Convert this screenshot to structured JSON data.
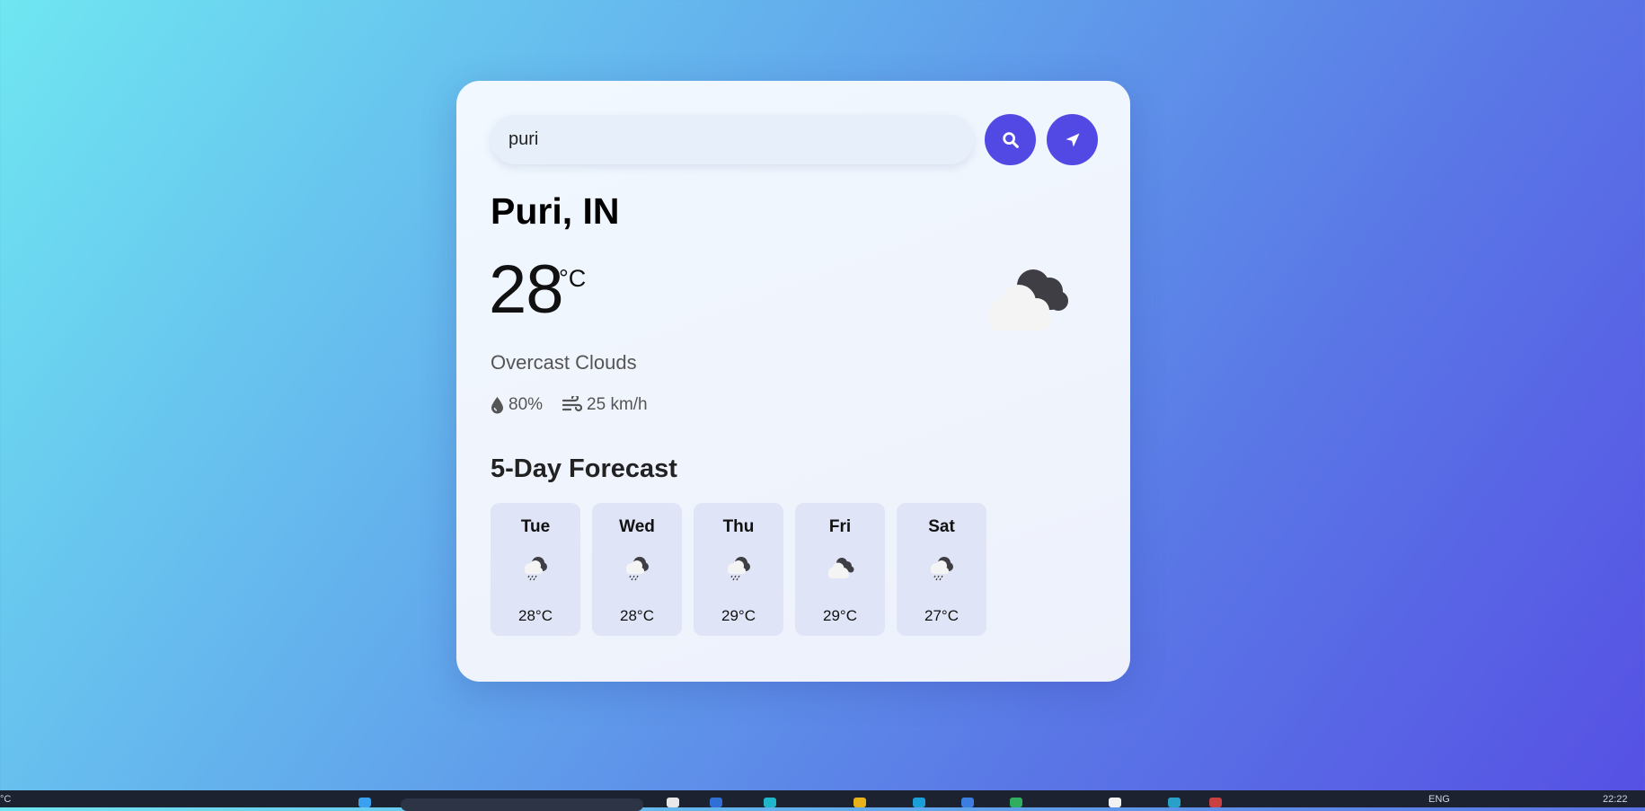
{
  "search": {
    "value": "puri"
  },
  "current": {
    "city": "Puri, IN",
    "temp": "28",
    "unit": "°C",
    "condition": "Overcast Clouds",
    "humidity": "80%",
    "wind": "25 km/h",
    "icon": "overcast-cloud-icon"
  },
  "forecast": {
    "title": "5-Day Forecast",
    "days": [
      {
        "day": "Tue",
        "temp": "28°C",
        "icon": "rain-cloud-icon"
      },
      {
        "day": "Wed",
        "temp": "28°C",
        "icon": "rain-cloud-icon"
      },
      {
        "day": "Thu",
        "temp": "29°C",
        "icon": "rain-cloud-icon"
      },
      {
        "day": "Fri",
        "temp": "29°C",
        "icon": "overcast-cloud-icon"
      },
      {
        "day": "Sat",
        "temp": "27°C",
        "icon": "rain-cloud-icon"
      }
    ]
  },
  "taskbar": {
    "left_text": "°C",
    "lang": "ENG",
    "time": "22:22"
  },
  "colors": {
    "accent": "#5249e4",
    "card": "#f1f8ff",
    "forecast_card": "#dfe4f6"
  }
}
